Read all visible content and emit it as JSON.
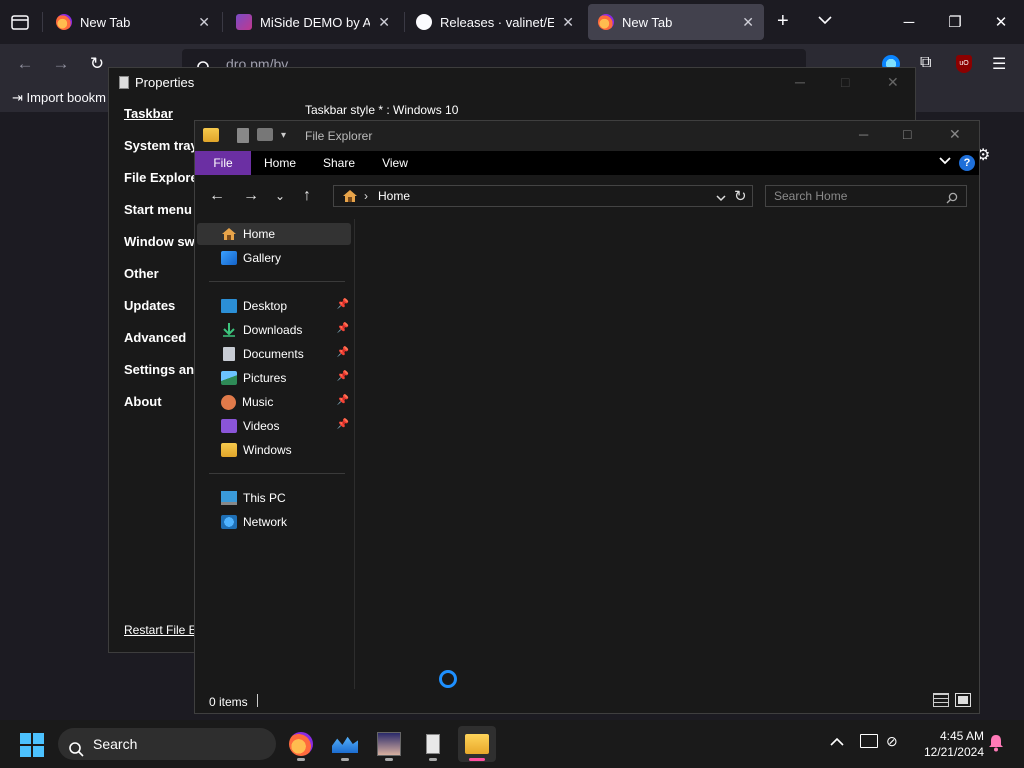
{
  "browser": {
    "tabs": [
      {
        "title": "New Tab",
        "active": false
      },
      {
        "title": "MiSide DEMO by Aihas",
        "active": false
      },
      {
        "title": "Releases · valinet/Explo",
        "active": false
      },
      {
        "title": "New Tab",
        "active": true
      }
    ],
    "url_text": "dro.pm/bv",
    "bookmark_label": "Import bookm",
    "new_tab_glyph": "+",
    "list_all_glyph": "⌵"
  },
  "properties": {
    "title": "Properties",
    "nav_items": [
      "Taskbar",
      "System tray",
      "File Explorer",
      "Start menu",
      "Window switcher",
      "Other",
      "Updates",
      "Advanced",
      "Settings and",
      "About"
    ],
    "restart_link": "Restart File Ex",
    "taskbar_style_line": "Taskbar style * : Windows 10"
  },
  "explorer": {
    "title": "File Explorer",
    "ribbon_tabs": [
      "File",
      "Home",
      "Share",
      "View"
    ],
    "address": "Home",
    "search_placeholder": "Search Home",
    "nav_groups": [
      [
        {
          "label": "Home",
          "icon": "home-icon",
          "pinned": false,
          "selected": true
        },
        {
          "label": "Gallery",
          "icon": "gallery-icon",
          "pinned": false,
          "selected": false
        }
      ],
      [
        {
          "label": "Desktop",
          "icon": "desktop-icon",
          "pinned": true,
          "selected": false
        },
        {
          "label": "Downloads",
          "icon": "downloads-icon",
          "pinned": true,
          "selected": false
        },
        {
          "label": "Documents",
          "icon": "documents-icon",
          "pinned": true,
          "selected": false
        },
        {
          "label": "Pictures",
          "icon": "pictures-icon",
          "pinned": true,
          "selected": false
        },
        {
          "label": "Music",
          "icon": "music-icon",
          "pinned": true,
          "selected": false
        },
        {
          "label": "Videos",
          "icon": "videos-icon",
          "pinned": true,
          "selected": false
        },
        {
          "label": "Windows",
          "icon": "folder-icon",
          "pinned": false,
          "selected": false
        }
      ],
      [
        {
          "label": "This PC",
          "icon": "this-pc-icon",
          "pinned": false,
          "selected": false
        },
        {
          "label": "Network",
          "icon": "network-icon",
          "pinned": false,
          "selected": false
        }
      ]
    ],
    "status_items": "0 items"
  },
  "taskbar": {
    "search_label": "Search",
    "apps": [
      {
        "name": "firefox",
        "active": false
      },
      {
        "name": "monitor-app",
        "active": false
      },
      {
        "name": "anime-avatar-app",
        "active": false
      },
      {
        "name": "properties-app",
        "active": false
      },
      {
        "name": "file-explorer",
        "active": true
      }
    ],
    "time": "4:45 AM",
    "date": "12/21/2024"
  },
  "colors": {
    "ribbon_file_accent": "#6b2fa3",
    "active_indicator": "#ff4fa0",
    "spinner": "#1e90ff"
  }
}
